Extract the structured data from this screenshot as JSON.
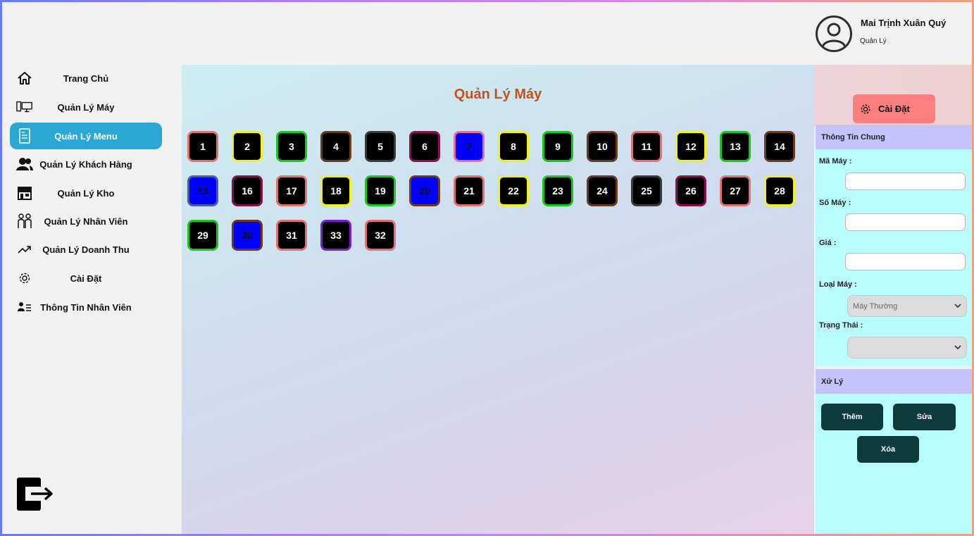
{
  "user": {
    "name": "Mai Trịnh Xuân Quý",
    "role": "Quản Lý"
  },
  "sidebar": {
    "items": [
      {
        "label": "Trang Chủ",
        "icon": "home-icon"
      },
      {
        "label": "Quản Lý Máy",
        "icon": "computer-icon"
      },
      {
        "label": "Quản Lý Menu",
        "icon": "menu-document-icon",
        "active": true
      },
      {
        "label": "Quản Lý Khách Hàng",
        "icon": "customers-icon"
      },
      {
        "label": "Quản Lý Kho",
        "icon": "store-icon"
      },
      {
        "label": "Quản Lý Nhân Viên",
        "icon": "staff-icon"
      },
      {
        "label": "Quản Lý Doanh Thu",
        "icon": "trend-up-icon"
      },
      {
        "label": "Cài Đặt",
        "icon": "gear-icon"
      },
      {
        "label": "Thông Tin Nhân Viên",
        "icon": "user-list-icon"
      }
    ],
    "logout_icon": "logout-icon"
  },
  "main": {
    "title": "Quản Lý Máy",
    "machines": [
      {
        "label": "1",
        "border": "#e0716c",
        "fill": "#000000"
      },
      {
        "label": "2",
        "border": "#f0f020",
        "fill": "#000000"
      },
      {
        "label": "3",
        "border": "#18c818",
        "fill": "#000000"
      },
      {
        "label": "4",
        "border": "#6b3a1e",
        "fill": "#000000"
      },
      {
        "label": "5",
        "border": "#3a3a3a",
        "fill": "#000000"
      },
      {
        "label": "6",
        "border": "#8a0f4f",
        "fill": "#000000"
      },
      {
        "label": "7",
        "border": "#e070a0",
        "fill": "#0000ff"
      },
      {
        "label": "8",
        "border": "#f0f020",
        "fill": "#000000"
      },
      {
        "label": "9",
        "border": "#18c818",
        "fill": "#000000"
      },
      {
        "label": "10",
        "border": "#6b3a1e",
        "fill": "#000000"
      },
      {
        "label": "11",
        "border": "#e0716c",
        "fill": "#000000"
      },
      {
        "label": "12",
        "border": "#f0f020",
        "fill": "#000000"
      },
      {
        "label": "13",
        "border": "#18c818",
        "fill": "#000000"
      },
      {
        "label": "14",
        "border": "#6b3a1e",
        "fill": "#000000"
      },
      {
        "label": "15",
        "border": "#4a5aa0",
        "fill": "#0000ff"
      },
      {
        "label": "16",
        "border": "#8a0f4f",
        "fill": "#000000"
      },
      {
        "label": "17",
        "border": "#e0716c",
        "fill": "#000000"
      },
      {
        "label": "18",
        "border": "#f0f020",
        "fill": "#000000"
      },
      {
        "label": "19",
        "border": "#18c818",
        "fill": "#000000"
      },
      {
        "label": "20",
        "border": "#6b3a1e",
        "fill": "#0000ff"
      },
      {
        "label": "21",
        "border": "#e0716c",
        "fill": "#000000"
      },
      {
        "label": "22",
        "border": "#f0f020",
        "fill": "#000000"
      },
      {
        "label": "23",
        "border": "#18c818",
        "fill": "#000000"
      },
      {
        "label": "24",
        "border": "#6b3a1e",
        "fill": "#000000"
      },
      {
        "label": "25",
        "border": "#3a3a3a",
        "fill": "#000000"
      },
      {
        "label": "26",
        "border": "#8a0f4f",
        "fill": "#000000"
      },
      {
        "label": "27",
        "border": "#e0716c",
        "fill": "#000000"
      },
      {
        "label": "28",
        "border": "#f0f020",
        "fill": "#000000"
      },
      {
        "label": "29",
        "border": "#18c818",
        "fill": "#000000"
      },
      {
        "label": "30",
        "border": "#6b3a1e",
        "fill": "#0000ff"
      },
      {
        "label": "31",
        "border": "#e0716c",
        "fill": "#000000"
      },
      {
        "label": "33",
        "border": "#7a1fd0",
        "fill": "#000000"
      },
      {
        "label": "32",
        "border": "#e0716c",
        "fill": "#000000"
      }
    ]
  },
  "panel": {
    "settings_label": "Cài Đặt",
    "info_header": "Thông Tin Chung",
    "fields": {
      "ma_may": {
        "label": "Mã Máy :",
        "value": ""
      },
      "so_may": {
        "label": "Số Máy :",
        "value": ""
      },
      "gia": {
        "label": "Giá :",
        "value": ""
      },
      "loai_may": {
        "label": "Loại Máy :",
        "value": "Máy Thường"
      },
      "trang_thai": {
        "label": "Trạng Thái :",
        "value": ""
      }
    },
    "actions_header": "Xử Lý",
    "actions": {
      "add": "Thêm",
      "edit": "Sửa",
      "delete": "Xóa"
    }
  },
  "colors": {
    "accent": "#2aa7d4",
    "title": "#c8511b",
    "settings_button": "#fb7f7f",
    "action_button": "#0c3b3b",
    "panel_header": "#c4c3fb",
    "panel_body": "#b9fcfd"
  }
}
